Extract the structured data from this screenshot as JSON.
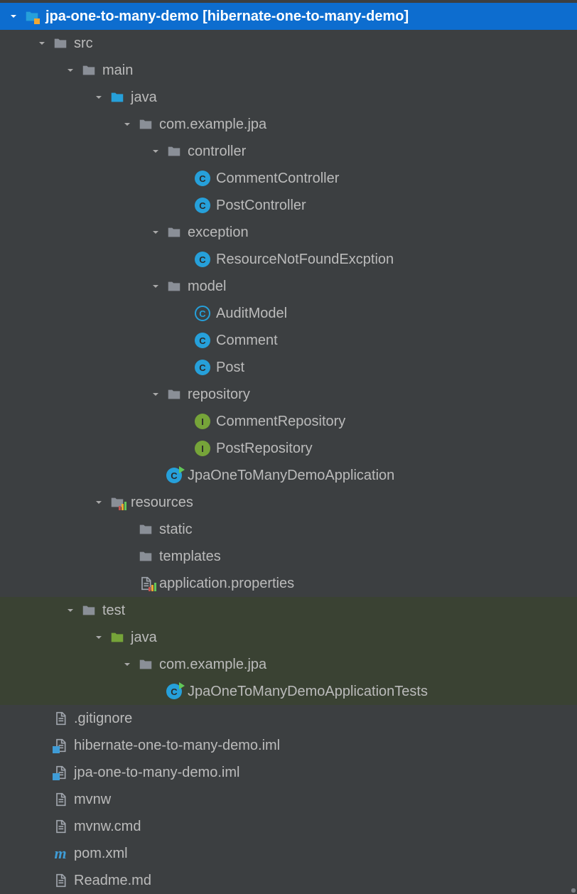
{
  "tree": {
    "root": {
      "name": "jpa-one-to-many-demo",
      "suffix": "[hibernate-one-to-many-demo]"
    },
    "src": "src",
    "main": "main",
    "java_main": "java",
    "pkg_main": "com.example.jpa",
    "controller": "controller",
    "CommentController": "CommentController",
    "PostController": "PostController",
    "exception": "exception",
    "ResourceNotFoundException": "ResourceNotFoundExcption",
    "model": "model",
    "AuditModel": "AuditModel",
    "Comment": "Comment",
    "Post": "Post",
    "repository": "repository",
    "CommentRepository": "CommentRepository",
    "PostRepository": "PostRepository",
    "JpaOneToManyDemoApplication": "JpaOneToManyDemoApplication",
    "resources": "resources",
    "static": "static",
    "templates": "templates",
    "application_properties": "application.properties",
    "test": "test",
    "java_test": "java",
    "pkg_test": "com.example.jpa",
    "JpaOneToManyDemoApplicationTests": "JpaOneToManyDemoApplicationTests",
    "gitignore": ".gitignore",
    "hibernate_iml": "hibernate-one-to-many-demo.iml",
    "jpa_iml": "jpa-one-to-many-demo.iml",
    "mvnw": "mvnw",
    "mvnw_cmd": "mvnw.cmd",
    "pom_xml": "pom.xml",
    "readme": "Readme.md"
  },
  "letters": {
    "c": "C",
    "i": "I"
  }
}
